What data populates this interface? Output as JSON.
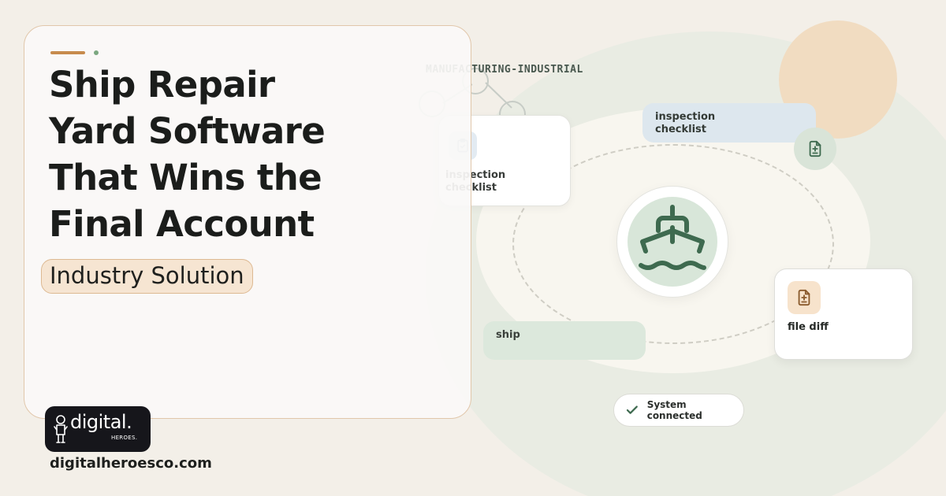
{
  "title_lines": [
    "Ship Repair",
    "Yard Software",
    "That Wins the",
    "Final Account"
  ],
  "badge": "Industry Solution",
  "category": "MANUFACTURING-INDUSTRIAL",
  "cards": {
    "inspection_card": "inspection checklist",
    "inspection_pill": "inspection checklist",
    "file_diff": "file diff",
    "ship_pill": "ship"
  },
  "status": "System connected",
  "brand": {
    "logo_word": "digital.",
    "logo_sub": "HEROES.",
    "url": "digitalheroesco.com"
  },
  "colors": {
    "accent": "#c78b4d",
    "green": "#3e6a4f",
    "badge_bg": "#f6e5d2"
  },
  "icons": [
    "clipboard-check-icon",
    "file-diff-icon",
    "ship-icon",
    "check-icon"
  ]
}
